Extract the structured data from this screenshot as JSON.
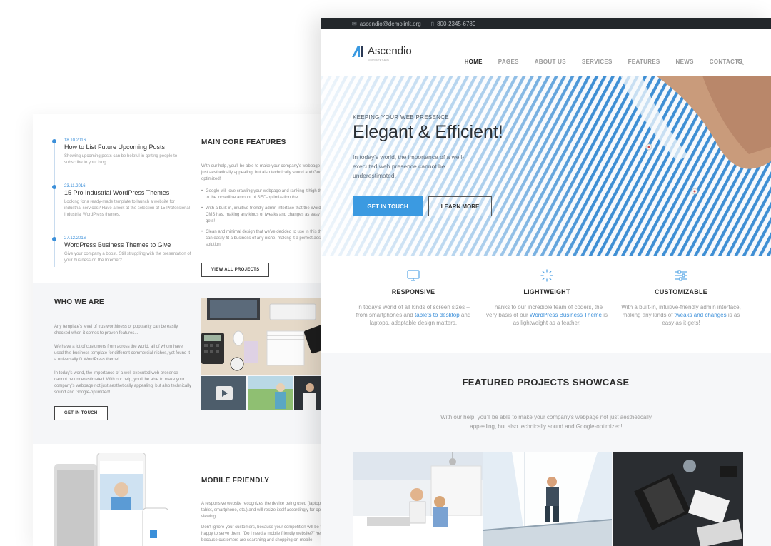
{
  "back_page": {
    "timeline": [
      {
        "date": "18.10.2016",
        "title": "How to List Future Upcoming Posts",
        "text": "Showing upcoming posts can be helpful in getting people to subscribe to your blog."
      },
      {
        "date": "23.11.2016",
        "title": "15 Pro Industrial WordPress Themes",
        "text": "Looking for a ready-made template to launch a website for industrial services? Have a look at the selection of 15 Professional Industrial WordPress themes."
      },
      {
        "date": "27.12.2016",
        "title": "WordPress Business Themes to Give",
        "text": "Give your company a boost. Still struggling with the presentation of your business on the Internet?"
      }
    ],
    "core": {
      "title": "MAIN CORE FEATURES",
      "intro": "With our help, you'll be able to make your company's webpage not just aesthetically appealing, but also technically sound and Google-optimized!",
      "bullets": [
        "Google will love crawling your webpage and ranking it high thanks to the incredible amount of SEO-optimization the",
        "With a built-in, intuitive-friendly admin interface that the WordPress CMS has, making any kinds of tweaks and changes as easy as it gets!",
        "Clean and minimal design that we've decided to use in this theme can easily fit a business of any niche, making it a perfect aesthetic solution!"
      ],
      "button": "VIEW ALL PROJECTS"
    },
    "who": {
      "title": "WHO WE ARE",
      "p1": "Any template's level of trustworthiness or popularity can be easily checked when it comes to proven features...",
      "p2": "We have a lot of customers from across the world, all of whom have used this business template for different commercial niches, yet found it a universally fit WordPress theme!",
      "p3": "In today's world, the importance of a well-executed web presence cannot be underestimated. With our help, you'll be able to make your company's webpage not just aesthetically appealing, but also technically sound and Google-optimized!",
      "button": "GET IN TOUCH"
    },
    "mobile": {
      "title": "MOBILE FRIENDLY",
      "p1": "A responsive website recognizes the device being used (laptop, tablet, smartphone, etc.) and will resize itself accordingly for optimal viewing.",
      "p2": "Don't ignore your customers, because your competition will be too happy to serve them. \"Do I need a mobile friendly website?\" Yes, because customers are searching and shopping on mobile"
    }
  },
  "front_page": {
    "topbar": {
      "email": "ascendio@demolink.org",
      "phone": "800-2345-6789"
    },
    "brand": {
      "name": "Ascendio",
      "tagline": "CORPORATE THEME"
    },
    "menu": [
      {
        "label": "HOME",
        "active": true
      },
      {
        "label": "PAGES",
        "active": false
      },
      {
        "label": "ABOUT US",
        "active": false
      },
      {
        "label": "SERVICES",
        "active": false
      },
      {
        "label": "FEATURES",
        "active": false
      },
      {
        "label": "NEWS",
        "active": false
      },
      {
        "label": "CONTACTS",
        "active": false
      }
    ],
    "hero": {
      "kicker": "KEEPING YOUR WEB PRESENCE",
      "title": "Elegant & Efficient!",
      "text": "In today's world, the importance of a well-executed web presence cannot be underestimated.",
      "primary": "GET IN TOUCH",
      "secondary": "LEARN MORE"
    },
    "features": [
      {
        "icon": "monitor-icon",
        "title": "RESPONSIVE",
        "pre": "In today's world of all kinds of screen sizes – from smartphones and ",
        "link": "tablets to desktop",
        "post": " and laptops, adaptable design matters."
      },
      {
        "icon": "loader-icon",
        "title": "LIGHTWEIGHT",
        "pre": "Thanks to our incredible team of coders, the very basis of our ",
        "link": "WordPress Business Theme",
        "post": " is as lightweight as a feather."
      },
      {
        "icon": "sliders-icon",
        "title": "CUSTOMIZABLE",
        "pre": "With a built-in, intuitive-friendly admin interface, making any kinds of ",
        "link": "tweaks and changes",
        "post": " is as easy as it gets!"
      }
    ],
    "showcase": {
      "title": "FEATURED PROJECTS SHOWCASE",
      "text": "With our help, you'll be able to make your company's webpage not just aesthetically appealing, but also technically sound and Google-optimized!"
    },
    "colors": {
      "accent": "#3b9ae1",
      "topbar": "#23272b",
      "stripe": "#3f8fd4"
    }
  }
}
